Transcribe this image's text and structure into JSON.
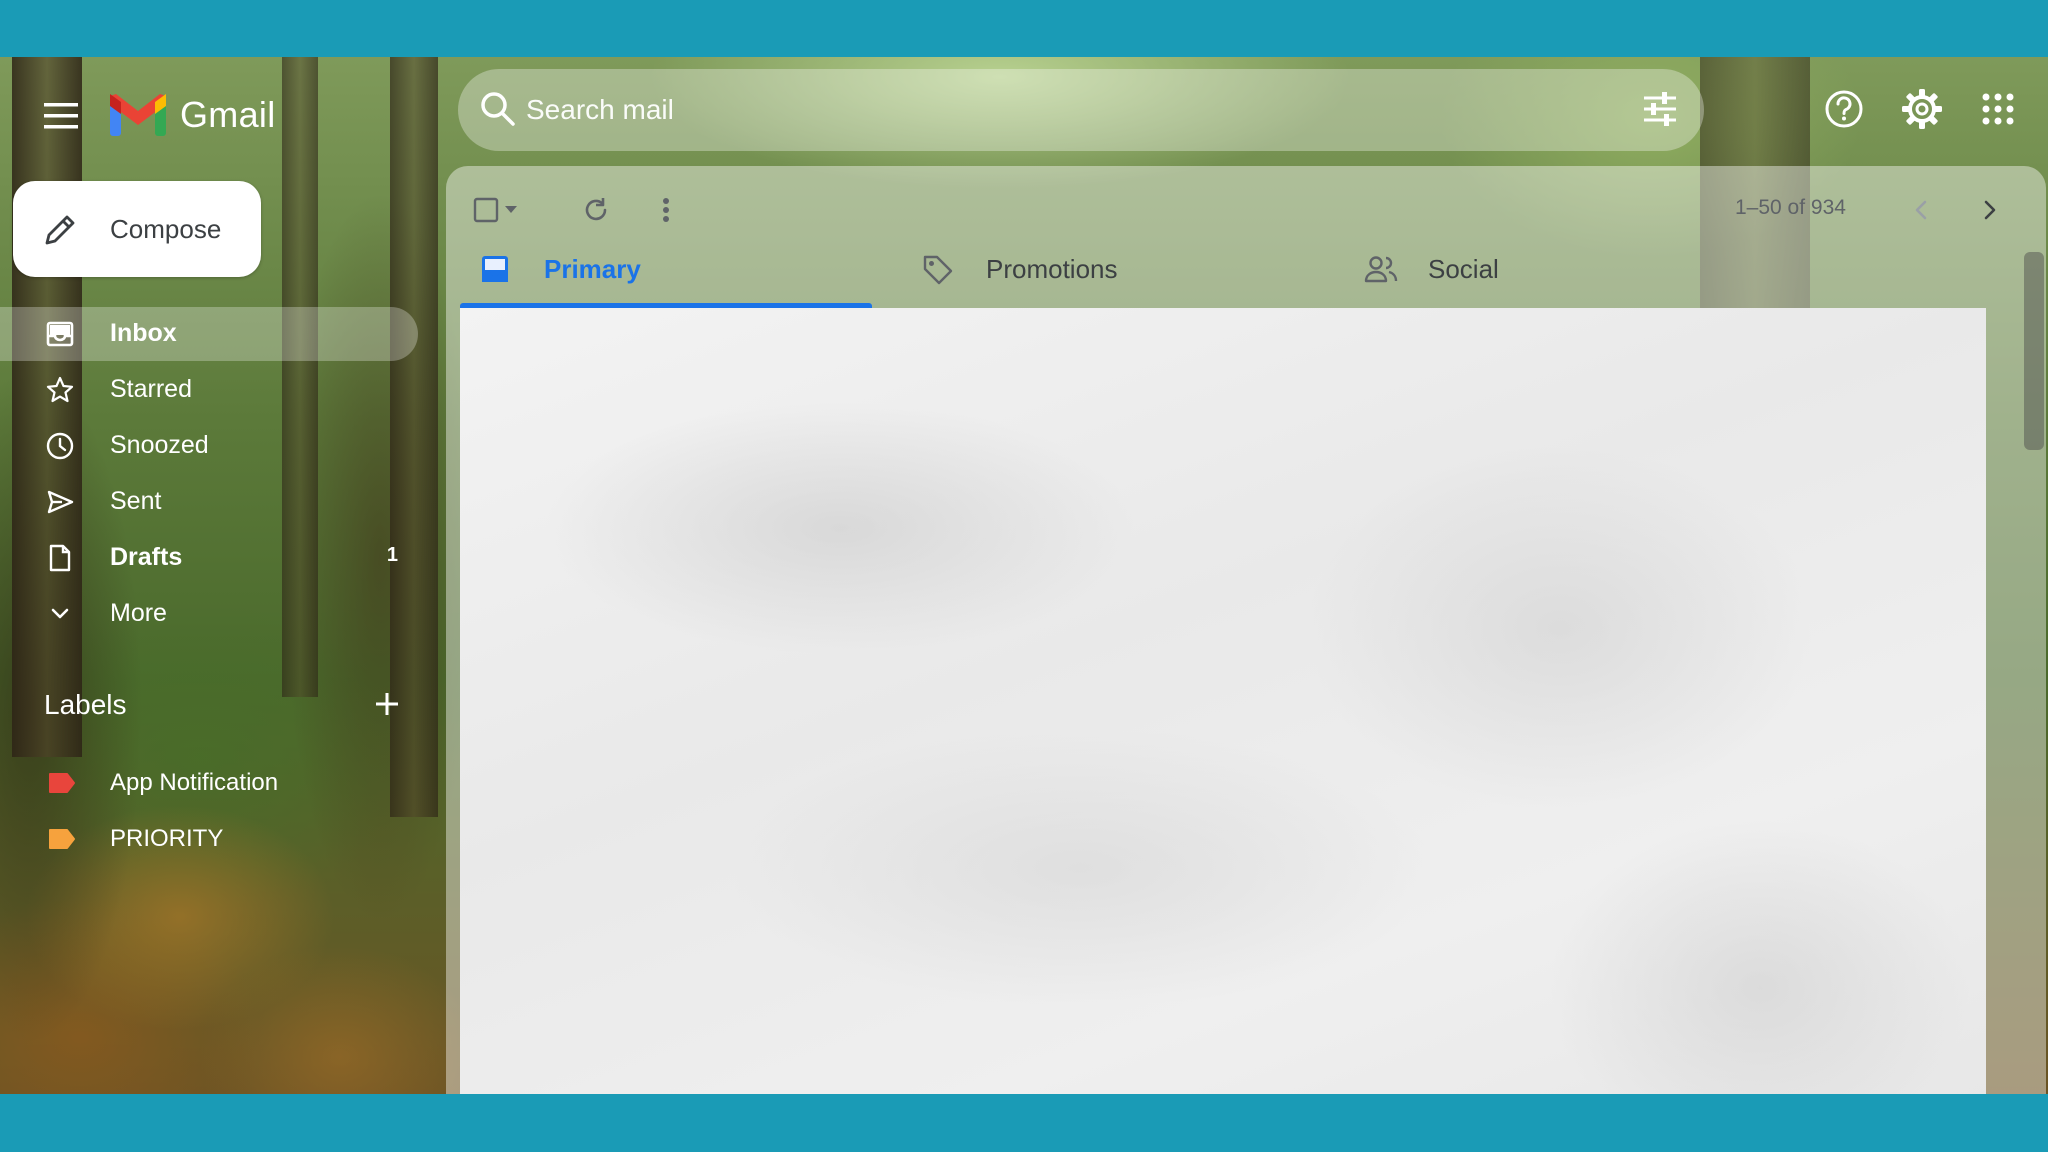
{
  "app": {
    "name": "Gmail"
  },
  "search": {
    "placeholder": "Search mail"
  },
  "compose": {
    "label": "Compose"
  },
  "nav": {
    "items": [
      {
        "label": "Inbox",
        "count": "",
        "icon": "inbox-icon"
      },
      {
        "label": "Starred",
        "count": "",
        "icon": "star-icon"
      },
      {
        "label": "Snoozed",
        "count": "",
        "icon": "clock-icon"
      },
      {
        "label": "Sent",
        "count": "",
        "icon": "send-icon"
      },
      {
        "label": "Drafts",
        "count": "1",
        "icon": "file-icon"
      },
      {
        "label": "More",
        "count": "",
        "icon": "chevron-down-icon"
      }
    ]
  },
  "labels": {
    "title": "Labels",
    "items": [
      {
        "label": "App Notification",
        "color": "#e8453c"
      },
      {
        "label": "PRIORITY",
        "color": "#f6a23d"
      }
    ]
  },
  "toolbar": {
    "page_info": "1–50 of 934"
  },
  "tabs": [
    {
      "label": "Primary",
      "icon": "inbox-tab-icon",
      "active": true
    },
    {
      "label": "Promotions",
      "icon": "tag-icon",
      "active": false
    },
    {
      "label": "Social",
      "icon": "people-icon",
      "active": false
    }
  ],
  "colors": {
    "frame": "#1a9bb6",
    "accent": "#1a73e8"
  }
}
